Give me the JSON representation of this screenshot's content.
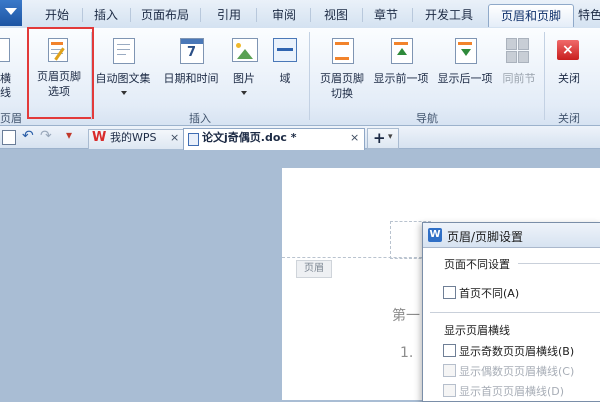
{
  "tabs": [
    "开始",
    "插入",
    "页面布局",
    "引用",
    "审阅",
    "视图",
    "章节",
    "开发工具",
    "页眉和页脚",
    "特色"
  ],
  "active_tab": "页眉和页脚",
  "ribbon": {
    "partial_left_label": "横线",
    "partial_left_group": "页眉页脚",
    "options_label_1": "页眉页脚",
    "options_label_2": "选项",
    "autotext": "自动图文集",
    "datetime": "日期和时间",
    "picture": "图片",
    "field": "域",
    "switch_1": "页眉页脚",
    "switch_2": "切换",
    "show_prev": "显示前一项",
    "show_next": "显示后一项",
    "same_prev": "同前节",
    "close": "关闭",
    "group_insert": "插入",
    "group_nav": "导航",
    "group_close": "关闭"
  },
  "doc_tabs": {
    "wps_home": "我的WPS",
    "current_doc": "论文j奇偶页.doc *",
    "close_glyph": "×",
    "add_glyph": "+"
  },
  "page": {
    "header_tag": "页眉",
    "body_line1": "第一",
    "body_line2": "1."
  },
  "dialog": {
    "title": "页眉/页脚设置",
    "section1": "页面不同设置",
    "opt_first_page": "首页不同(A)",
    "section2": "显示页眉横线",
    "opt_odd": "显示奇数页页眉横线(B)",
    "opt_even": "显示偶数页页眉横线(C)",
    "opt_first": "显示首页页眉横线(D)"
  },
  "colors": {
    "accent_blue": "#1d55a3",
    "highlight_red": "#e23a3a",
    "wps_red": "#d92b2b",
    "workspace": "#a9bdd4"
  }
}
